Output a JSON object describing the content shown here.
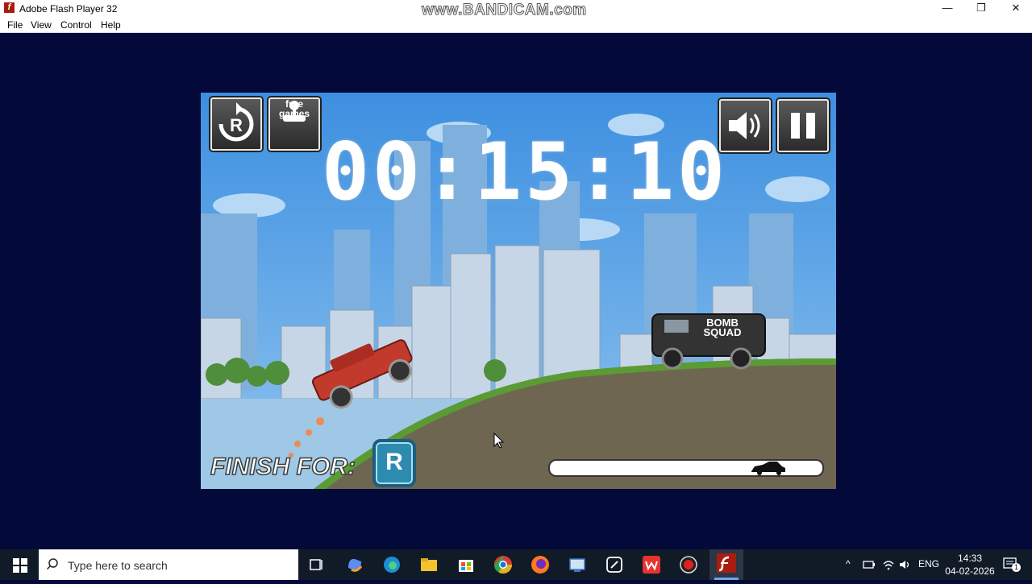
{
  "window": {
    "title": "Adobe Flash Player 32",
    "app_icon_glyph": "f",
    "watermark": "www.BANDICAM.com",
    "controls": {
      "minimize": "—",
      "restore": "❐",
      "close": "✕"
    }
  },
  "menu": [
    "File",
    "View",
    "Control",
    "Help"
  ],
  "game": {
    "restart_glyph": "R",
    "free_games_label_1": "free",
    "free_games_label_2": "games",
    "timer": "00:15:10",
    "van_label_1": "BOMB",
    "van_label_2": "SQUAD",
    "finish_label": "FINISH FOR:",
    "finish_badge": "R",
    "progress_fraction": 0.86
  },
  "taskbar": {
    "search_placeholder": "Type here to search",
    "language": "ENG",
    "time": "14:33",
    "date": "04-02-2026",
    "notification_count": "1",
    "app_icons": [
      "task-view-icon",
      "copilot-icon",
      "edge-icon",
      "file-explorer-icon",
      "store-icon",
      "chrome-icon",
      "firefox-icon",
      "network-app-icon",
      "link-app-icon",
      "wps-icon",
      "record-icon",
      "flash-player-icon"
    ],
    "colors": {
      "taskbar": "#111b27",
      "chrome": "#e0b324",
      "firefox": "#ff7a1c",
      "wps": "#e7332f",
      "flash": "#a81d12"
    }
  }
}
